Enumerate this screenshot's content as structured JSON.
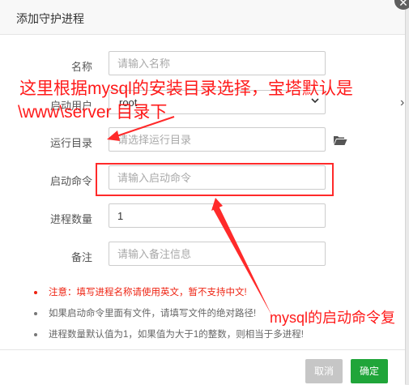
{
  "dialog": {
    "title": "添加守护进程",
    "close_glyph": "✕"
  },
  "form": {
    "name": {
      "label": "名称",
      "placeholder": "请输入名称"
    },
    "user": {
      "label": "启动用户",
      "value": "root"
    },
    "run_dir": {
      "label": "运行目录",
      "placeholder": "请选择运行目录"
    },
    "start_cmd": {
      "label": "启动命令",
      "placeholder": "请输入启动命令"
    },
    "proc_count": {
      "label": "进程数量",
      "value": "1"
    },
    "remark": {
      "label": "备注",
      "placeholder": "请输入备注信息"
    }
  },
  "tips": [
    {
      "text": "注意：填写进程名称请使用英文，暂不支持中文!",
      "color": "#ee2211"
    },
    {
      "text": "如果启动命令里面有文件，请填写文件的绝对路径!"
    },
    {
      "text": "进程数量默认值为1，如果值为大于1的整数，则相当于多进程!"
    }
  ],
  "footer": {
    "cancel_label": "取消",
    "confirm_label": "确定"
  },
  "annotations": {
    "line1": "这里根据mysql的安装目录选择，宝塔默认是",
    "line2": "\\www\\server 目录下",
    "line3": "mysql的启动命令复",
    "color": "#ff1a1a"
  },
  "icons": {
    "folder": "folder-open-icon",
    "close": "close-icon",
    "dropdown": "chevron-down-icon"
  },
  "colors": {
    "confirm": "#20a53a",
    "cancel": "#c6c6c6"
  }
}
